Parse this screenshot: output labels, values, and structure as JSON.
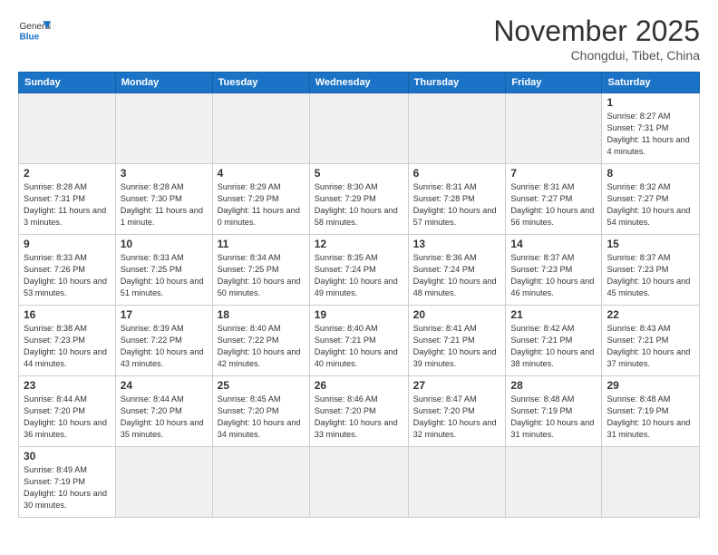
{
  "logo": {
    "general": "General",
    "blue": "Blue"
  },
  "header": {
    "month": "November 2025",
    "location": "Chongdui, Tibet, China"
  },
  "days_of_week": [
    "Sunday",
    "Monday",
    "Tuesday",
    "Wednesday",
    "Thursday",
    "Friday",
    "Saturday"
  ],
  "weeks": [
    [
      {
        "day": "",
        "info": ""
      },
      {
        "day": "",
        "info": ""
      },
      {
        "day": "",
        "info": ""
      },
      {
        "day": "",
        "info": ""
      },
      {
        "day": "",
        "info": ""
      },
      {
        "day": "",
        "info": ""
      },
      {
        "day": "1",
        "info": "Sunrise: 8:27 AM\nSunset: 7:31 PM\nDaylight: 11 hours and 4 minutes."
      }
    ],
    [
      {
        "day": "2",
        "info": "Sunrise: 8:28 AM\nSunset: 7:31 PM\nDaylight: 11 hours and 3 minutes."
      },
      {
        "day": "3",
        "info": "Sunrise: 8:28 AM\nSunset: 7:30 PM\nDaylight: 11 hours and 1 minute."
      },
      {
        "day": "4",
        "info": "Sunrise: 8:29 AM\nSunset: 7:29 PM\nDaylight: 11 hours and 0 minutes."
      },
      {
        "day": "5",
        "info": "Sunrise: 8:30 AM\nSunset: 7:29 PM\nDaylight: 10 hours and 58 minutes."
      },
      {
        "day": "6",
        "info": "Sunrise: 8:31 AM\nSunset: 7:28 PM\nDaylight: 10 hours and 57 minutes."
      },
      {
        "day": "7",
        "info": "Sunrise: 8:31 AM\nSunset: 7:27 PM\nDaylight: 10 hours and 56 minutes."
      },
      {
        "day": "8",
        "info": "Sunrise: 8:32 AM\nSunset: 7:27 PM\nDaylight: 10 hours and 54 minutes."
      }
    ],
    [
      {
        "day": "9",
        "info": "Sunrise: 8:33 AM\nSunset: 7:26 PM\nDaylight: 10 hours and 53 minutes."
      },
      {
        "day": "10",
        "info": "Sunrise: 8:33 AM\nSunset: 7:25 PM\nDaylight: 10 hours and 51 minutes."
      },
      {
        "day": "11",
        "info": "Sunrise: 8:34 AM\nSunset: 7:25 PM\nDaylight: 10 hours and 50 minutes."
      },
      {
        "day": "12",
        "info": "Sunrise: 8:35 AM\nSunset: 7:24 PM\nDaylight: 10 hours and 49 minutes."
      },
      {
        "day": "13",
        "info": "Sunrise: 8:36 AM\nSunset: 7:24 PM\nDaylight: 10 hours and 48 minutes."
      },
      {
        "day": "14",
        "info": "Sunrise: 8:37 AM\nSunset: 7:23 PM\nDaylight: 10 hours and 46 minutes."
      },
      {
        "day": "15",
        "info": "Sunrise: 8:37 AM\nSunset: 7:23 PM\nDaylight: 10 hours and 45 minutes."
      }
    ],
    [
      {
        "day": "16",
        "info": "Sunrise: 8:38 AM\nSunset: 7:23 PM\nDaylight: 10 hours and 44 minutes."
      },
      {
        "day": "17",
        "info": "Sunrise: 8:39 AM\nSunset: 7:22 PM\nDaylight: 10 hours and 43 minutes."
      },
      {
        "day": "18",
        "info": "Sunrise: 8:40 AM\nSunset: 7:22 PM\nDaylight: 10 hours and 42 minutes."
      },
      {
        "day": "19",
        "info": "Sunrise: 8:40 AM\nSunset: 7:21 PM\nDaylight: 10 hours and 40 minutes."
      },
      {
        "day": "20",
        "info": "Sunrise: 8:41 AM\nSunset: 7:21 PM\nDaylight: 10 hours and 39 minutes."
      },
      {
        "day": "21",
        "info": "Sunrise: 8:42 AM\nSunset: 7:21 PM\nDaylight: 10 hours and 38 minutes."
      },
      {
        "day": "22",
        "info": "Sunrise: 8:43 AM\nSunset: 7:21 PM\nDaylight: 10 hours and 37 minutes."
      }
    ],
    [
      {
        "day": "23",
        "info": "Sunrise: 8:44 AM\nSunset: 7:20 PM\nDaylight: 10 hours and 36 minutes."
      },
      {
        "day": "24",
        "info": "Sunrise: 8:44 AM\nSunset: 7:20 PM\nDaylight: 10 hours and 35 minutes."
      },
      {
        "day": "25",
        "info": "Sunrise: 8:45 AM\nSunset: 7:20 PM\nDaylight: 10 hours and 34 minutes."
      },
      {
        "day": "26",
        "info": "Sunrise: 8:46 AM\nSunset: 7:20 PM\nDaylight: 10 hours and 33 minutes."
      },
      {
        "day": "27",
        "info": "Sunrise: 8:47 AM\nSunset: 7:20 PM\nDaylight: 10 hours and 32 minutes."
      },
      {
        "day": "28",
        "info": "Sunrise: 8:48 AM\nSunset: 7:19 PM\nDaylight: 10 hours and 31 minutes."
      },
      {
        "day": "29",
        "info": "Sunrise: 8:48 AM\nSunset: 7:19 PM\nDaylight: 10 hours and 31 minutes."
      }
    ],
    [
      {
        "day": "30",
        "info": "Sunrise: 8:49 AM\nSunset: 7:19 PM\nDaylight: 10 hours and 30 minutes."
      },
      {
        "day": "",
        "info": ""
      },
      {
        "day": "",
        "info": ""
      },
      {
        "day": "",
        "info": ""
      },
      {
        "day": "",
        "info": ""
      },
      {
        "day": "",
        "info": ""
      },
      {
        "day": "",
        "info": ""
      }
    ]
  ]
}
